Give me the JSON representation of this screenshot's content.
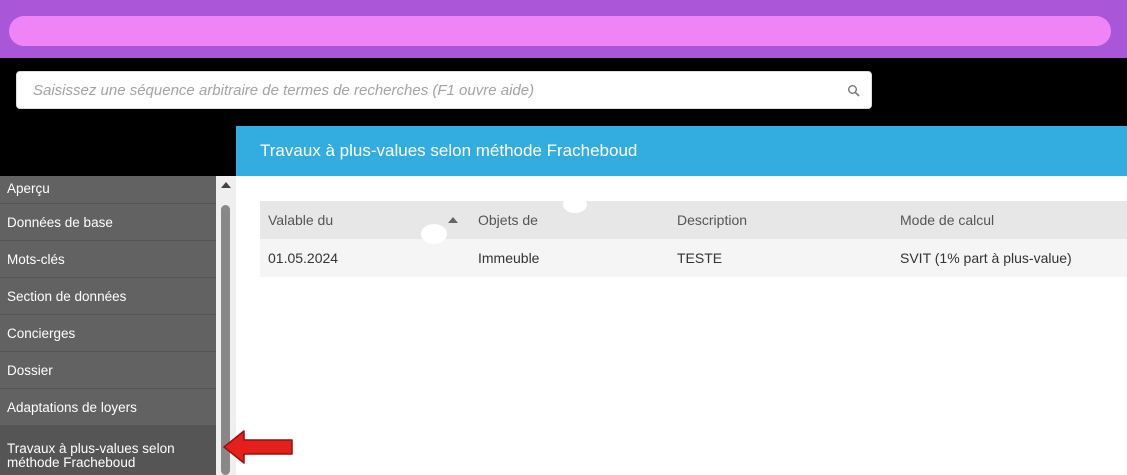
{
  "search": {
    "placeholder": "Saisissez une séquence arbitraire de termes de recherches (F1 ouvre aide)"
  },
  "page": {
    "title": "Travaux à plus-values selon méthode Fracheboud"
  },
  "sidebar": {
    "items": [
      {
        "label": "Aperçu"
      },
      {
        "label": "Données de base"
      },
      {
        "label": "Mots-clés"
      },
      {
        "label": "Section de données"
      },
      {
        "label": "Concierges"
      },
      {
        "label": "Dossier"
      },
      {
        "label": "Adaptations de loyers"
      },
      {
        "label_line1": "Travaux à plus-values selon",
        "label_line2": "méthode Fracheboud"
      }
    ]
  },
  "table": {
    "columns": [
      "Valable du",
      "Objets de",
      "Description",
      "Mode de calcul"
    ],
    "rows": [
      [
        "01.05.2024",
        "Immeuble",
        "TESTE",
        "SVIT (1% part à plus-value)"
      ]
    ]
  },
  "colors": {
    "title_bar": "#33ade0",
    "sidebar_bg": "#626262",
    "top_strip": "#a957d8",
    "pill": "#ee84f5",
    "arrow": "#e3201b"
  }
}
